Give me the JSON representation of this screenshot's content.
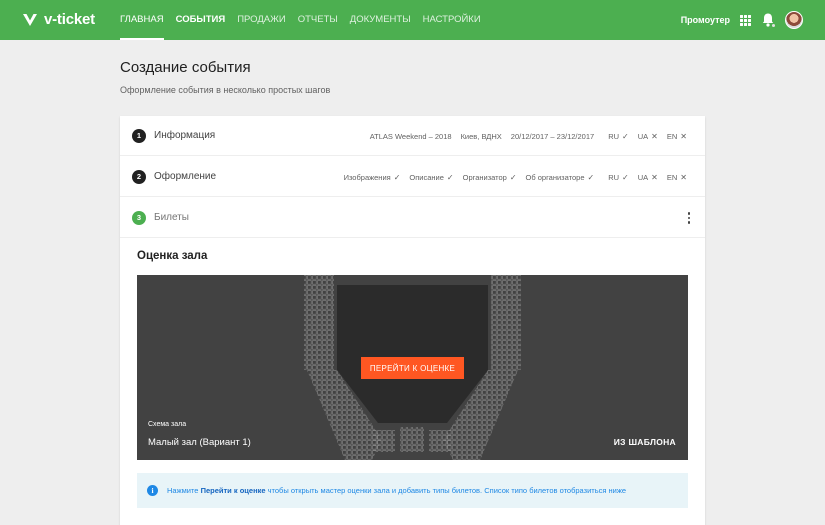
{
  "app": {
    "logo_text": "v-ticket"
  },
  "nav": [
    {
      "label": "ГЛАВНАЯ",
      "active": true
    },
    {
      "label": "СОБЫТИЯ",
      "bold": true
    },
    {
      "label": "ПРОДАЖИ"
    },
    {
      "label": "ОТЧЕТЫ"
    },
    {
      "label": "ДОКУМЕНТЫ"
    },
    {
      "label": "НАСТРОЙКИ"
    }
  ],
  "user": {
    "role": "Промоутер"
  },
  "page": {
    "title": "Создание события",
    "subtitle": "Оформление события в несколько простых шагов"
  },
  "steps": [
    {
      "number": "1",
      "title": "Информация",
      "meta": [
        "ATLAS Weekend – 2018",
        "Киев, ВДНХ",
        "20/12/2017 – 23/12/2017"
      ],
      "languages": [
        {
          "code": "RU",
          "status": "✓"
        },
        {
          "code": "UA",
          "status": "✕"
        },
        {
          "code": "EN",
          "status": "✕"
        }
      ]
    },
    {
      "number": "2",
      "title": "Оформление",
      "items": [
        {
          "label": "Изображения",
          "status": "✓"
        },
        {
          "label": "Описание",
          "status": "✓"
        },
        {
          "label": "Организатор",
          "status": "✓"
        },
        {
          "label": "Об организаторе",
          "status": "✓"
        }
      ],
      "languages": [
        {
          "code": "RU",
          "status": "✓"
        },
        {
          "code": "UA",
          "status": "✕"
        },
        {
          "code": "EN",
          "status": "✕"
        }
      ]
    },
    {
      "number": "3",
      "title": "Билеты"
    }
  ],
  "hall": {
    "section_title": "Оценка зала",
    "button_label": "ПЕРЕЙТИ К ОЦЕНКЕ",
    "caption": "Схема зала",
    "name": "Малый зал (Вариант 1)",
    "template_label": "ИЗ ШАБЛОНА"
  },
  "info": {
    "icon": "i",
    "prefix": "Нажмите",
    "link": "Перейти к оценке",
    "suffix": "чтобы открыть мастер оценки зала и добавить типы билетов. Список типо билетов отобразиться ниже"
  },
  "colors": {
    "topbar": "#4caf50",
    "accent_button": "#ff5722",
    "info_text": "#1e88e5",
    "scheme_bg": "#424242"
  }
}
